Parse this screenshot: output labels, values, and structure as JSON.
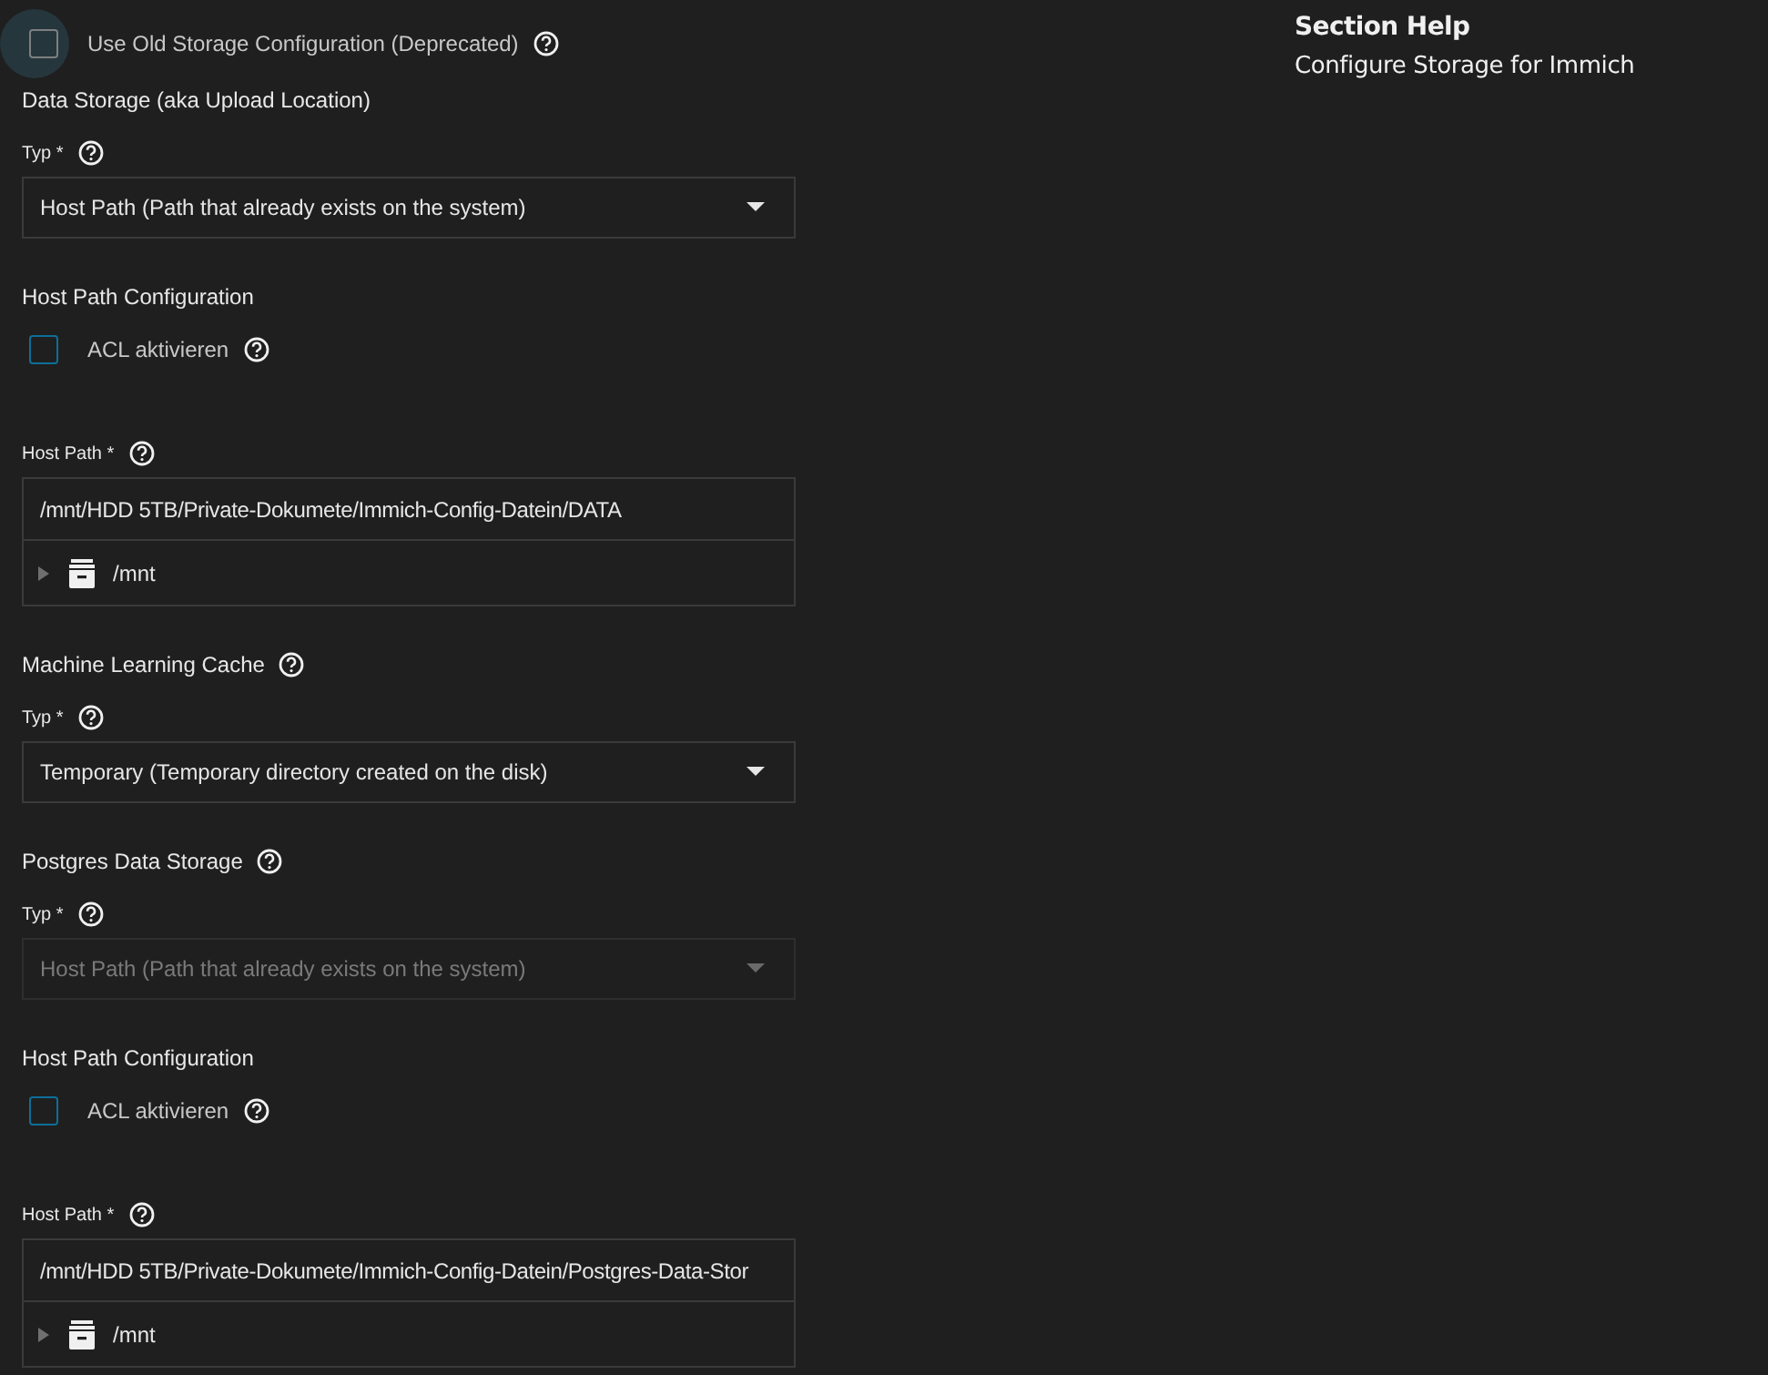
{
  "form": [
    {
      "kind": "checkbox",
      "label": "Use Old Storage Configuration (Deprecated)",
      "checked": false,
      "focused": true,
      "help": true
    },
    {
      "kind": "heading",
      "text": "Data Storage (aka Upload Location)",
      "help": false
    },
    {
      "kind": "select",
      "label": "Typ *",
      "help": true,
      "value": "Host Path (Path that already exists on the system)",
      "disabled": false
    },
    {
      "kind": "heading",
      "text": "Host Path Configuration",
      "help": false
    },
    {
      "kind": "checkbox",
      "label": "ACL aktivieren",
      "checked": false,
      "focused": false,
      "help": true
    },
    {
      "kind": "path",
      "label": "Host Path *",
      "help": true,
      "value": "/mnt/HDD 5TB/Private-Dokumete/Immich-Config-Datein/DATA",
      "tree": {
        "label": "/mnt",
        "expanded": false
      }
    },
    {
      "kind": "heading",
      "text": "Machine Learning Cache",
      "help": true
    },
    {
      "kind": "select",
      "label": "Typ *",
      "help": true,
      "value": "Temporary (Temporary directory created on the disk)",
      "disabled": false
    },
    {
      "kind": "heading",
      "text": "Postgres Data Storage",
      "help": true
    },
    {
      "kind": "select",
      "label": "Typ *",
      "help": true,
      "value": "Host Path (Path that already exists on the system)",
      "disabled": true
    },
    {
      "kind": "heading",
      "text": "Host Path Configuration",
      "help": false
    },
    {
      "kind": "checkbox",
      "label": "ACL aktivieren",
      "checked": false,
      "focused": false,
      "help": true
    },
    {
      "kind": "path",
      "label": "Host Path *",
      "help": true,
      "value": "/mnt/HDD 5TB/Private-Dokumete/Immich-Config-Datein/Postgres-Data-Stor",
      "tree": {
        "label": "/mnt",
        "expanded": false
      }
    }
  ],
  "section_help": {
    "title": "Section Help",
    "text": "Configure Storage for Immich"
  }
}
